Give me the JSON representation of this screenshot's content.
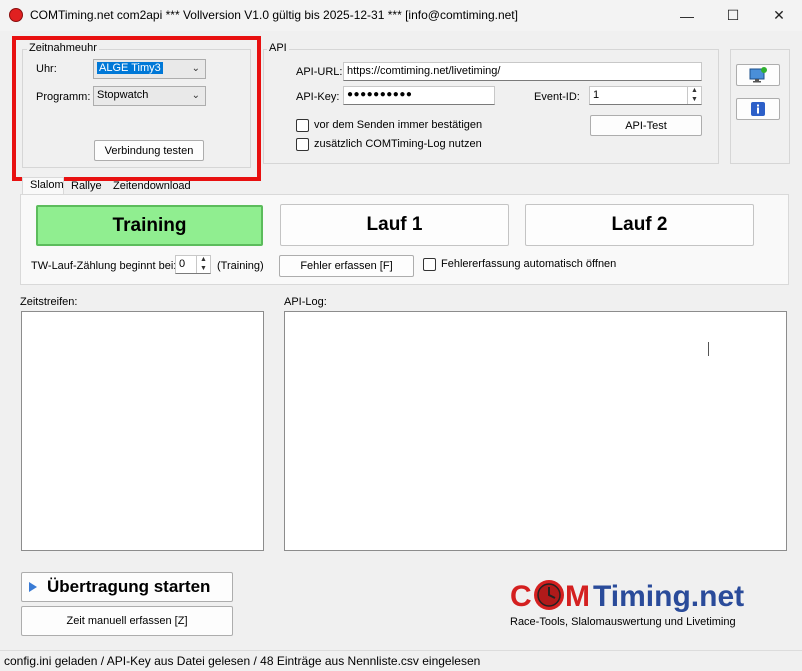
{
  "window": {
    "title": "COMTiming.net com2api *** Vollversion V1.0 gültig bis 2025-12-31 *** [info@comtiming.net]",
    "minimize": "—",
    "maximize": "☐",
    "close": "✕"
  },
  "zeitnahmeuhr": {
    "title": "Zeitnahmeuhr",
    "uhr_label": "Uhr:",
    "uhr_value": "ALGE Timy3",
    "programm_label": "Programm:",
    "programm_value": "Stopwatch",
    "test_button": "Verbindung testen"
  },
  "api": {
    "title": "API",
    "url_label": "API-URL:",
    "url_value": "https://comtiming.net/livetiming/",
    "key_label": "API-Key:",
    "key_value": "●●●●●●●●●●",
    "event_label": "Event-ID:",
    "event_value": "1",
    "confirm_label": "vor dem Senden immer bestätigen",
    "log_label": "zusätzlich COMTiming-Log nutzen",
    "test_button": "API-Test"
  },
  "tabs": [
    "Slalom",
    "Rallye",
    "Zeitendownload"
  ],
  "slalom": {
    "training": "Training",
    "lauf1": "Lauf 1",
    "lauf2": "Lauf 2",
    "tw_label": "TW-Lauf-Zählung beginnt bei:",
    "tw_value": "0",
    "tw_note": "(Training)",
    "fehler_button": "Fehler erfassen [F]",
    "auto_label": "Fehlererfassung automatisch öffnen",
    "training_color": "#90ee90"
  },
  "zeitstreifen": {
    "label": "Zeitstreifen:"
  },
  "apilog": {
    "label": "API-Log:"
  },
  "actions": {
    "start": "Übertragung starten",
    "manual": "Zeit manuell erfassen [Z]"
  },
  "logo": {
    "text": "COMTiming.net",
    "tagline": "Race-Tools, Slalomauswertung und Livetiming",
    "red": "#d42020",
    "blue": "#2a4b9a"
  },
  "statusbar": {
    "text": "config.ini geladen / API-Key aus Datei gelesen / 48 Einträge aus Nennliste.csv eingelesen"
  },
  "highlight": {
    "color": "#e81010"
  }
}
